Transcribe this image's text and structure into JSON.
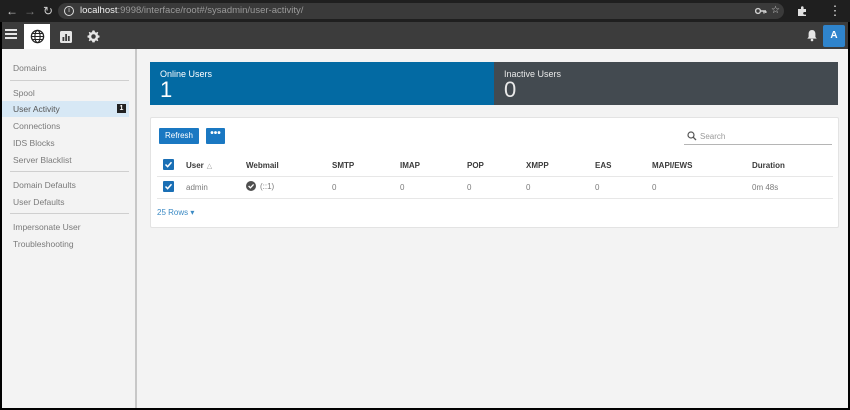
{
  "browser": {
    "url_host": "localhost",
    "url_rest": ":9998/interface/root#/sysadmin/user-activity/"
  },
  "topbar": {
    "tabs": [
      "globe-icon",
      "chart-icon",
      "gear-icon"
    ],
    "avatar_initial": "A"
  },
  "sidebar": {
    "items": [
      {
        "label": "Domains"
      },
      {
        "label": "Spool"
      },
      {
        "label": "User Activity",
        "badge": "1"
      },
      {
        "label": "Connections"
      },
      {
        "label": "IDS Blocks"
      },
      {
        "label": "Server Blacklist"
      },
      {
        "label": "Domain Defaults"
      },
      {
        "label": "User Defaults"
      },
      {
        "label": "Impersonate User"
      },
      {
        "label": "Troubleshooting"
      }
    ]
  },
  "stats": {
    "online": {
      "label": "Online Users",
      "value": "1"
    },
    "inactive": {
      "label": "Inactive Users",
      "value": "0"
    }
  },
  "toolbar": {
    "refresh_label": "Refresh",
    "more_label": "•••",
    "search_placeholder": "Search"
  },
  "table": {
    "columns": [
      "User",
      "Webmail",
      "SMTP",
      "IMAP",
      "POP",
      "XMPP",
      "EAS",
      "MAPI/EWS",
      "Duration"
    ],
    "rows": [
      {
        "user": "admin",
        "webmail": "(::1)",
        "smtp": "0",
        "imap": "0",
        "pop": "0",
        "xmpp": "0",
        "eas": "0",
        "mapi": "0",
        "duration": "0m 48s"
      }
    ],
    "rows_per_page": "25 Rows"
  },
  "colors": {
    "accent": "#1a78c2",
    "online_bg": "#036aa3",
    "inactive_bg": "#434a50",
    "selected_side": "#d7e8f5"
  }
}
